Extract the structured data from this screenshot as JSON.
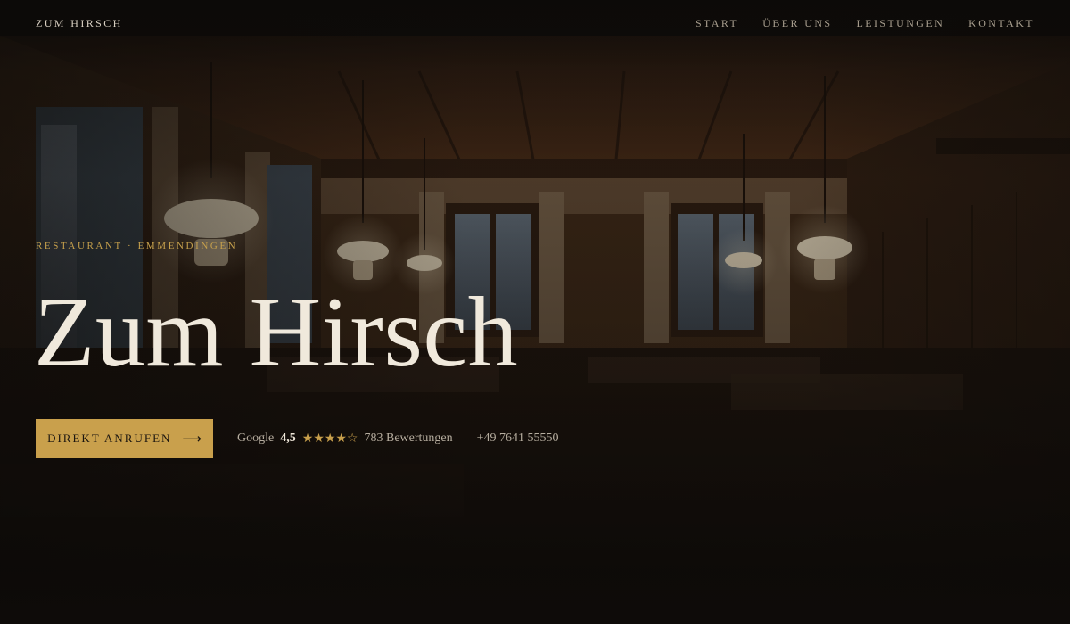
{
  "nav": {
    "brand": "ZUM HIRSCH",
    "items": [
      {
        "label": "START"
      },
      {
        "label": "ÜBER UNS"
      },
      {
        "label": "LEISTUNGEN"
      },
      {
        "label": "KONTAKT"
      }
    ]
  },
  "hero": {
    "eyebrow": "RESTAURANT · EMMENDINGEN",
    "title": "Zum Hirsch",
    "cta_label": "DIREKT ANRUFEN",
    "cta_icon": "arrow-right-icon",
    "rating": {
      "source": "Google",
      "score": "4,5",
      "stars": "★★★★☆",
      "stars_value": 4.5,
      "reviews": "783 Bewertungen"
    },
    "phone": "+49 7641 55550"
  },
  "colors": {
    "accent": "#c9a04c",
    "background": "#0f0c0a",
    "text": "#f0e9dc"
  }
}
